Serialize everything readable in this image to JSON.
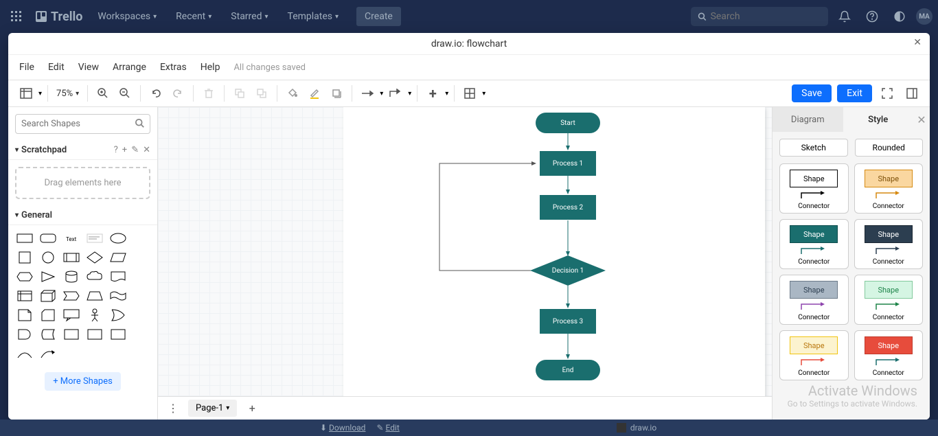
{
  "trello": {
    "logo": "Trello",
    "nav": [
      "Workspaces",
      "Recent",
      "Starred",
      "Templates"
    ],
    "create": "Create",
    "search_placeholder": "Search",
    "avatar": "MA"
  },
  "drawio": {
    "title": "draw.io: flowchart",
    "menu": [
      "File",
      "Edit",
      "View",
      "Arrange",
      "Extras",
      "Help"
    ],
    "save_status": "All changes saved",
    "zoom": "75%",
    "save_btn": "Save",
    "exit_btn": "Exit"
  },
  "left": {
    "search_placeholder": "Search Shapes",
    "scratchpad": "Scratchpad",
    "scratch_hint": "Drag elements here",
    "general": "General",
    "more_shapes": "+ More Shapes"
  },
  "flowchart": {
    "start": "Start",
    "p1": "Process 1",
    "p2": "Process 2",
    "d1": "Decision 1",
    "p3": "Process 3",
    "end": "End"
  },
  "right": {
    "tab_diagram": "Diagram",
    "tab_style": "Style",
    "sketch": "Sketch",
    "rounded": "Rounded",
    "shape": "Shape",
    "connector": "Connector"
  },
  "pages": {
    "page1": "Page-1"
  },
  "bottom": {
    "download": "Download",
    "edit": "Edit",
    "drawio": "draw.io"
  },
  "watermark": {
    "l1": "Activate Windows",
    "l2": "Go to Settings to activate Windows."
  },
  "style_palette": [
    {
      "bg": "#ffffff",
      "border": "#000000",
      "text": "#000000",
      "conn": "#000000"
    },
    {
      "bg": "#fad7a0",
      "border": "#d68910",
      "text": "#7e5109",
      "conn": "#d68910"
    },
    {
      "bg": "#1a6e6e",
      "border": "#0e4d4d",
      "text": "#ffffff",
      "conn": "#1a6e6e"
    },
    {
      "bg": "#2c3e50",
      "border": "#1b2631",
      "text": "#ffffff",
      "conn": "#2c3e50"
    },
    {
      "bg": "#aab7c4",
      "border": "#6c7a89",
      "text": "#2c3e50",
      "conn": "#8e44ad"
    },
    {
      "bg": "#d5f5e3",
      "border": "#82c99c",
      "text": "#1e8449",
      "conn": "#1e8449"
    },
    {
      "bg": "#fcf3cf",
      "border": "#f1c40f",
      "text": "#b9770e",
      "conn": "#e74c3c"
    },
    {
      "bg": "#e74c3c",
      "border": "#c0392b",
      "text": "#ffffff",
      "conn": "#1a6e6e"
    }
  ]
}
